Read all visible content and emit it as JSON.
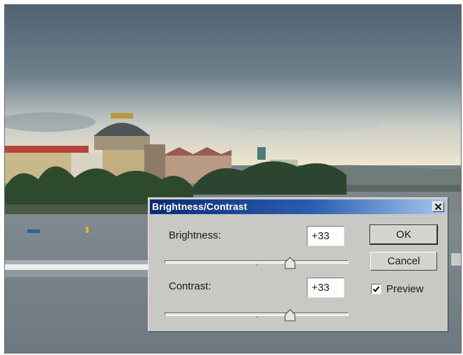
{
  "dialog": {
    "title": "Brightness/Contrast",
    "brightness": {
      "label": "Brightness:",
      "value": "+33",
      "level": 0.68
    },
    "contrast": {
      "label": "Contrast:",
      "value": "+33",
      "level": 0.68
    },
    "ok_label": "OK",
    "cancel_label": "Cancel",
    "preview_label": "Preview",
    "preview_checked": true,
    "close_icon": "close-icon"
  },
  "colors": {
    "titlebar_start": "#0a2a74",
    "titlebar_end": "#a7c7ef",
    "dialog_face": "#c8c8c4"
  }
}
